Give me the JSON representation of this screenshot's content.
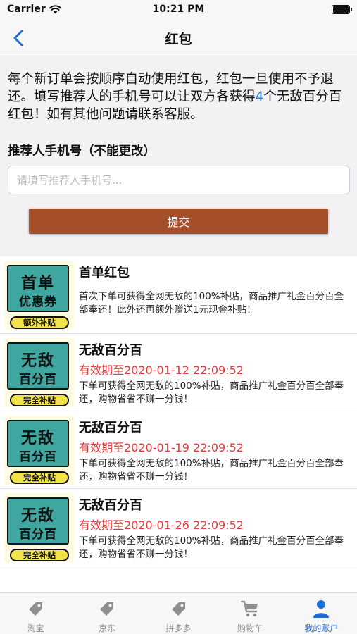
{
  "status_bar": {
    "carrier": "Carrier",
    "time": "10:21 PM"
  },
  "nav": {
    "title": "红包"
  },
  "intro": {
    "text_before": "每个新订单会按顺序自动使用红包，红包一旦使用不予退还。填写推荐人的手机号可以让双方各获得",
    "count": "4",
    "text_after": "个无敌百分百红包！如有其他问题请联系客服。"
  },
  "referrer": {
    "label": "推荐人手机号（不能更改）",
    "placeholder": "请填写推荐人手机号...",
    "value": "",
    "submit_label": "提交"
  },
  "coupons": [
    {
      "title": "首单红包",
      "expiry": "",
      "description": "首次下单可获得全网无敌的100%补贴，商品推广礼金百分百全部奉还！此外还再额外赠送1元现金补贴！",
      "badge_line1": "首单",
      "badge_line2": "优惠券",
      "badge_tag": "额外补贴"
    },
    {
      "title": "无敌百分百",
      "expiry": "有效期至2020-01-12 22:09:52",
      "description": "下单可获得全网无敌的100%补贴，商品推广礼金百分百全部奉还，购物省省不赚一分钱！",
      "badge_line1": "无敌",
      "badge_line2": "百分百",
      "badge_tag": "完全补贴"
    },
    {
      "title": "无敌百分百",
      "expiry": "有效期至2020-01-19 22:09:52",
      "description": "下单可获得全网无敌的100%补贴，商品推广礼金百分百全部奉还，购物省省不赚一分钱！",
      "badge_line1": "无敌",
      "badge_line2": "百分百",
      "badge_tag": "完全补贴"
    },
    {
      "title": "无敌百分百",
      "expiry": "有效期至2020-01-26 22:09:52",
      "description": "下单可获得全网无敌的100%补贴，商品推广礼金百分百全部奉还，购物省省不赚一分钱！",
      "badge_line1": "无敌",
      "badge_line2": "百分百",
      "badge_tag": "完全补贴"
    }
  ],
  "tabs": [
    {
      "label": "淘宝",
      "icon": "tag-icon",
      "active": false
    },
    {
      "label": "京东",
      "icon": "tag-icon",
      "active": false
    },
    {
      "label": "拼多多",
      "icon": "tag-icon",
      "active": false
    },
    {
      "label": "购物车",
      "icon": "cart-icon",
      "active": false
    },
    {
      "label": "我的账户",
      "icon": "person-icon",
      "active": true
    }
  ],
  "colors": {
    "accent": "#1f6fd6",
    "submit_button": "#a64f2b",
    "expiry_text": "#e23b3b",
    "badge_teal": "#3fa7a0",
    "badge_yellow": "#f3e34a"
  }
}
